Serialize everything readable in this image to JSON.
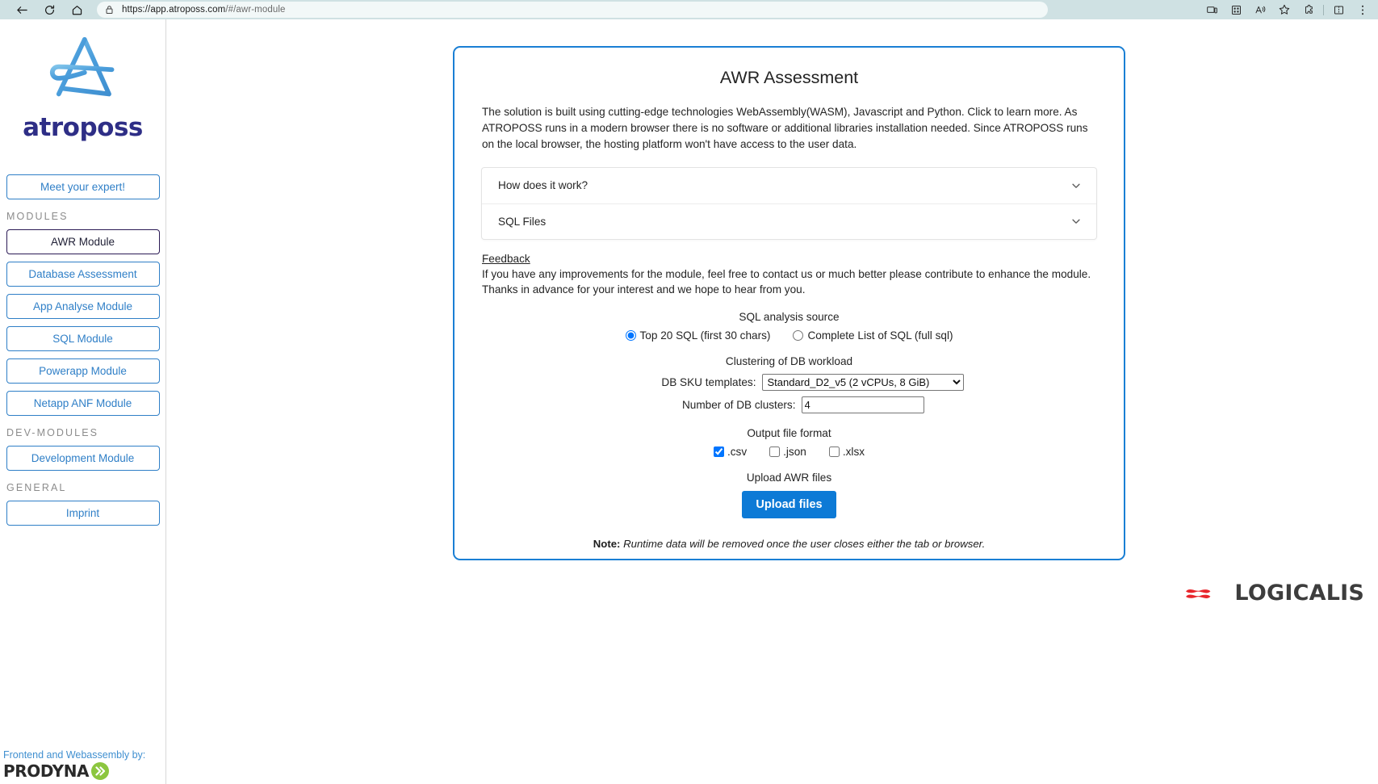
{
  "browser": {
    "back_icon": "back-arrow-icon",
    "reload_icon": "reload-icon",
    "home_icon": "home-icon",
    "lock_icon": "lock-icon",
    "url_host": "https://app.atroposs.com",
    "url_path": "/#/awr-module",
    "toolbar_icons": [
      "device-cast-icon",
      "collections-icon",
      "read-aloud-icon",
      "favorites-star-icon",
      "extensions-icon",
      "split-screen-icon"
    ]
  },
  "sidebar": {
    "logo_text": "atroposs",
    "meet_expert_label": "Meet your expert!",
    "groups": [
      {
        "heading": "MODULES",
        "items": [
          {
            "label": "AWR Module",
            "active": true
          },
          {
            "label": "Database Assessment",
            "active": false
          },
          {
            "label": "App Analyse Module",
            "active": false
          },
          {
            "label": "SQL Module",
            "active": false
          },
          {
            "label": "Powerapp Module",
            "active": false
          },
          {
            "label": "Netapp ANF Module",
            "active": false
          }
        ]
      },
      {
        "heading": "DEV-MODULES",
        "items": [
          {
            "label": "Development Module",
            "active": false
          }
        ]
      },
      {
        "heading": "GENERAL",
        "items": [
          {
            "label": "Imprint",
            "active": false
          }
        ]
      }
    ],
    "credit_text": "Frontend and Webassembly by:",
    "credit_brand": "PRODYNA"
  },
  "card": {
    "title": "AWR Assessment",
    "intro": "The solution is built using cutting-edge technologies WebAssembly(WASM), Javascript and Python. Click to learn more. As ATROPOSS runs in a modern browser there is no software or additional libraries installation needed. Since ATROPOSS runs on the local browser, the hosting platform won't have access to the user data.",
    "accordion": [
      {
        "label": "How does it work?"
      },
      {
        "label": "SQL Files"
      }
    ],
    "feedback_link": "Feedback",
    "feedback_line1": "If you have any improvements for the module, feel free to contact us or much better please contribute to enhance the module.",
    "feedback_line2": "Thanks in advance for your interest and we hope to hear from you.",
    "sql_source": {
      "label": "SQL analysis source",
      "options": [
        {
          "label": "Top 20 SQL (first 30 chars)",
          "checked": true
        },
        {
          "label": "Complete List of SQL (full sql)",
          "checked": false
        }
      ]
    },
    "clustering": {
      "label": "Clustering of DB workload",
      "sku_label": "DB SKU templates:",
      "sku_value": "Standard_D2_v5 (2 vCPUs, 8 GiB)",
      "clusters_label": "Number of DB clusters:",
      "clusters_value": "4"
    },
    "output_format": {
      "label": "Output file format",
      "options": [
        {
          "label": ".csv",
          "checked": true
        },
        {
          "label": ".json",
          "checked": false
        },
        {
          "label": ".xlsx",
          "checked": false
        }
      ]
    },
    "upload": {
      "label": "Upload AWR files",
      "button_label": "Upload files"
    },
    "note_prefix": "Note:",
    "note_text": " Runtime data will be removed once the user closes either the tab or browser."
  },
  "brand": {
    "logicalis": "LOGICALIS"
  },
  "colors": {
    "accent_blue": "#1a7fd4",
    "button_blue": "#0d7ad6",
    "sidebar_blue": "#2f7fc7",
    "logo_purple": "#2e2e86",
    "logicalis_red": "#e8262c",
    "prodyna_green": "#8cc63f",
    "chrome_bg": "#cfe1e3"
  }
}
